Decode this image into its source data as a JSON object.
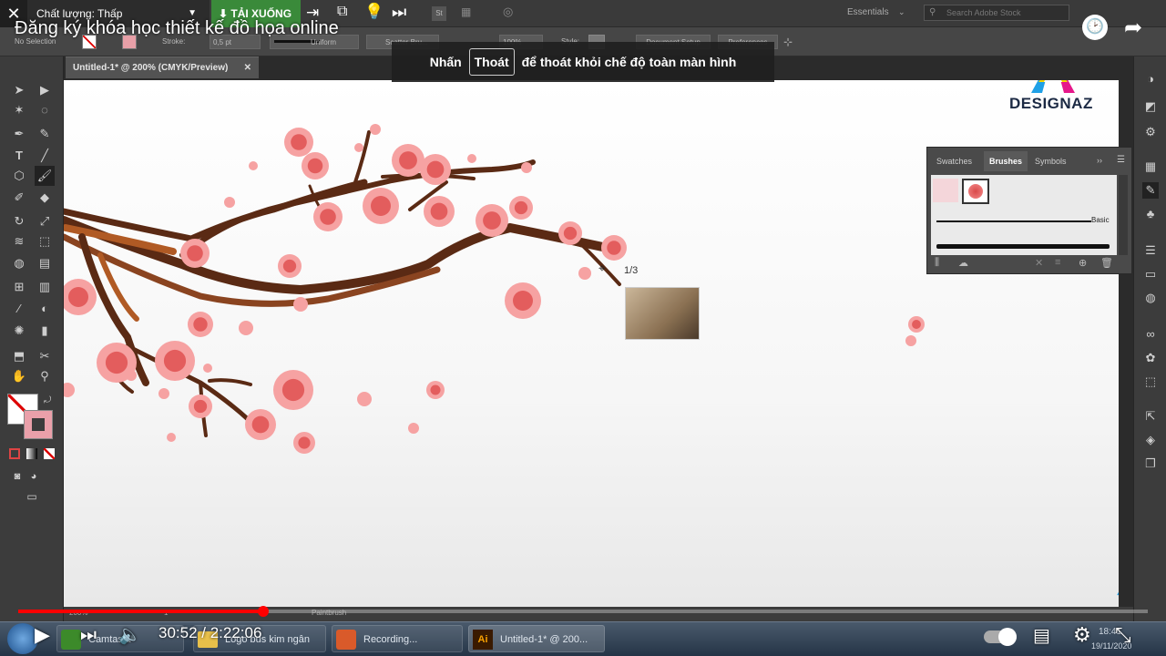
{
  "youtube": {
    "title": "Đăng ký khóa học thiết kế đồ họa online",
    "quality_label": "Chất lượng: Thấp",
    "download_label": "TẢI XUỐNG",
    "fullscreen_notice": {
      "before": "Nhấn",
      "key": "Thoát",
      "after": "để thoát khỏi chế độ toàn màn hình"
    },
    "time_current": "30:52",
    "time_total": "2:22:06",
    "time_text": "30:52 / 2:22:06",
    "progress_fraction": 0.217,
    "accent": "#ff0000"
  },
  "illustrator": {
    "workspace": "Essentials",
    "search_placeholder": "Search Adobe Stock",
    "control_bar": {
      "selection": "No Selection",
      "stroke_label": "Stroke:",
      "stroke_value": "0,5 pt",
      "profile": "Uniform",
      "brush": "Scatter Bru...",
      "opacity": "100%",
      "style_label": "Style:",
      "doc_setup": "Document Setup",
      "preferences": "Preferences"
    },
    "doc_tab": "Untitled-1* @ 200% (CMYK/Preview)",
    "status": {
      "zoom": "200%",
      "page": "1",
      "tool": "Paintbrush"
    },
    "panel": {
      "tabs": [
        "Swatches",
        "Brushes",
        "Symbols"
      ],
      "active_tab": "Brushes",
      "brush_basic": "Basic"
    },
    "cursor_page": "1/3"
  },
  "brand": {
    "logo_text": "DESIGNAZ"
  },
  "taskbar": {
    "items": [
      "Camtasia",
      "Logo bus kim ngân",
      "Recording...",
      "Untitled-1* @ 200..."
    ],
    "clock_time": "18:41",
    "clock_date": "19/11/2020"
  }
}
